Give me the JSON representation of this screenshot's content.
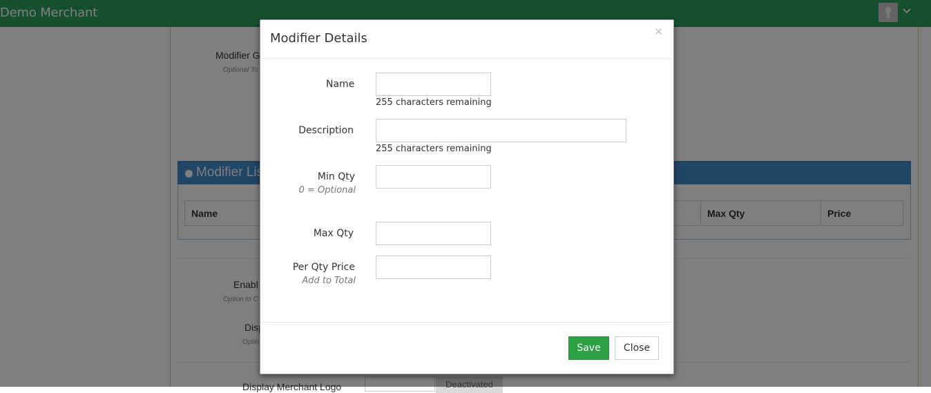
{
  "topbar": {
    "brand": "Demo Merchant",
    "avatar_icon": "user-avatar-icon",
    "menu_icon": "chevron-down-icon",
    "color": "#2ea05f"
  },
  "background": {
    "modifier_group_label": "Modifier G",
    "modifier_group_hint": "Optional To",
    "panel_title": "Modifier Lis",
    "panel_color": "#428bca",
    "table_headers": [
      "Name",
      "Max Qty",
      "Price"
    ],
    "enable_label": "Enabl",
    "enable_hint": "Option to C",
    "display_label": "Disp",
    "display_hint": "Optio",
    "bottom_label": "Display Merchant Logo",
    "bottom_button": "Deactivated"
  },
  "modal": {
    "title": "Modifier Details",
    "close_symbol": "×",
    "fields": {
      "name": {
        "label": "Name",
        "value": "",
        "counter": "255 characters remaining"
      },
      "description": {
        "label": "Description",
        "value": "",
        "counter": "255 characters remaining"
      },
      "min_qty": {
        "label": "Min Qty",
        "hint": "0 = Optional",
        "value": ""
      },
      "max_qty": {
        "label": "Max Qty",
        "value": ""
      },
      "per_qty_price": {
        "label": "Per Qty Price",
        "hint": "Add to Total",
        "value": ""
      }
    },
    "buttons": {
      "save": "Save",
      "close": "Close"
    },
    "save_color": "#2ea043"
  }
}
